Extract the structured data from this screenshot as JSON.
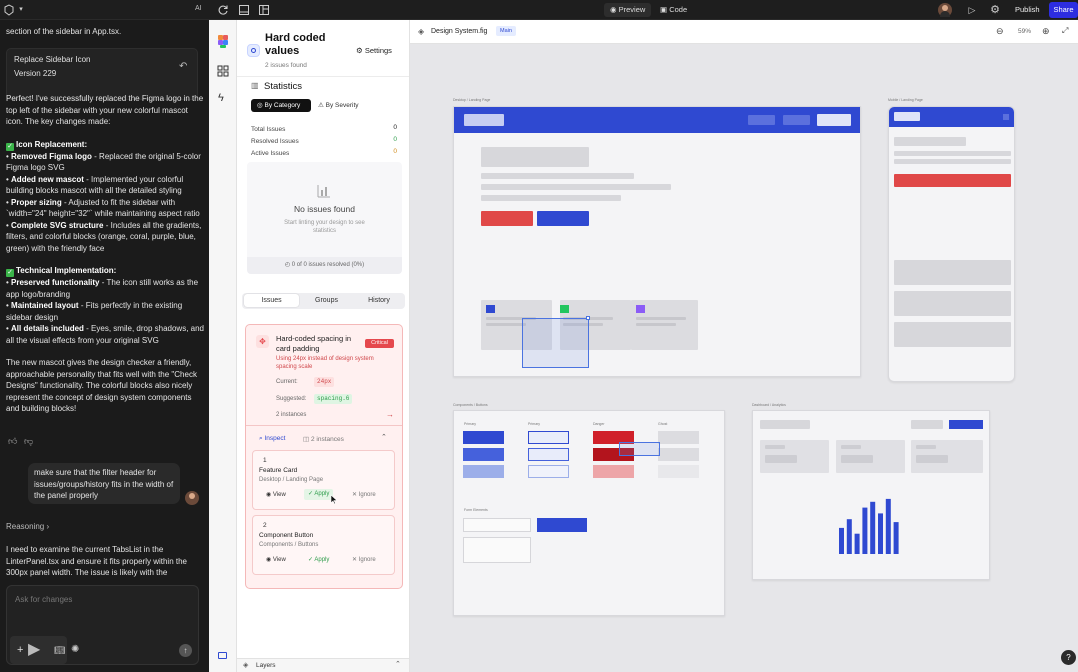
{
  "topbar": {
    "ai_label": "AI",
    "preview_label": "Preview",
    "code_label": "Code",
    "publish_label": "Publish",
    "share_label": "Share"
  },
  "chat": {
    "intro_text": "section of the sidebar in App.tsx.",
    "version_card": {
      "title": "Replace Sidebar Icon",
      "version": "Version 229"
    },
    "summary": "Perfect! I've successfully replaced the Figma logo in the top left of the sidebar with your new colorful mascot icon. The key changes made:",
    "icon_heading": "Icon Replacement:",
    "icon_items": [
      {
        "bold": "Removed Figma logo",
        "text": " - Replaced the original 5-color Figma logo SVG"
      },
      {
        "bold": "Added new mascot",
        "text": " - Implemented your colorful building blocks mascot with all the detailed styling"
      },
      {
        "bold": "Proper sizing",
        "text": " - Adjusted to fit the sidebar with `width=\"24\" height=\"32\"` while maintaining aspect ratio"
      },
      {
        "bold": "Complete SVG structure",
        "text": " - Includes all the gradients, filters, and colorful blocks (orange, coral, purple, blue, green) with the friendly face"
      }
    ],
    "tech_heading": "Technical Implementation:",
    "tech_items": [
      {
        "bold": "Preserved functionality",
        "text": " - The icon still works as the app logo/branding"
      },
      {
        "bold": "Maintained layout",
        "text": " - Fits perfectly in the existing sidebar design"
      },
      {
        "bold": "All details included",
        "text": " - Eyes, smile, drop shadows, and all the visual effects from your original SVG"
      }
    ],
    "closing": "The new mascot gives the design checker a friendly, approachable personality that fits well with the \"Check Designs\" functionality. The colorful blocks also nicely represent the concept of design system components and building blocks!",
    "user_message": "make sure that the filter header for issues/groups/history fits in the width of the panel properly",
    "reasoning_label": "Reasoning",
    "reasoning_text": "I need to examine the current TabsList in the LinterPanel.tsx and ensure it fits properly within the 300px panel width. The issue is likely with the",
    "input_placeholder": "Ask for changes"
  },
  "panel": {
    "title": "Hard coded values",
    "subtitle": "2 issues found",
    "settings_label": "Settings",
    "statistics_label": "Statistics",
    "by_category": "By Category",
    "by_severity": "By Severity",
    "stats": [
      {
        "label": "Total Issues",
        "value": "0",
        "color": "#222222"
      },
      {
        "label": "Resolved Issues",
        "value": "0",
        "color": "#2e9d4b"
      },
      {
        "label": "Active Issues",
        "value": "0",
        "color": "#d08a1a"
      }
    ],
    "empty_title": "No issues found",
    "empty_sub": "Start linting your design to see statistics",
    "resolved_text": "0 of 0 issues resolved (0%)",
    "tabs": [
      "Issues",
      "Groups",
      "History"
    ],
    "issue": {
      "title": "Hard-coded spacing in card padding",
      "badge": "Critical",
      "desc": "Using 24px instead of design system spacing scale",
      "current_label": "Current:",
      "current_value": "24px",
      "suggested_label": "Suggested:",
      "suggested_value": "spacing.6",
      "instances_text": "2 instances",
      "inspect_label": "Inspect",
      "inspect_count": "2 instances"
    },
    "instances": [
      {
        "num": "1",
        "name": "Feature Card",
        "path": "Desktop / Landing Page"
      },
      {
        "num": "2",
        "name": "Component Button",
        "path": "Components / Buttons"
      }
    ],
    "view_label": "View",
    "apply_label": "Apply",
    "ignore_label": "Ignore",
    "layers_label": "Layers"
  },
  "canvas": {
    "file_name": "Design System.fig",
    "branch": "Main",
    "zoom": "59%",
    "frames": {
      "desktop": "Desktop / Landing Page",
      "mobile": "Mobile / Landing Page",
      "components": "Components / Buttons",
      "dashboard": "Dashboard / Analytics"
    },
    "component_labels": [
      "Primary",
      "Primary",
      "Danger",
      "Ghost"
    ],
    "form_label": "Form Elements",
    "chart_bars": [
      0.45,
      0.6,
      0.35,
      0.8,
      0.9,
      0.7,
      0.95,
      0.55
    ]
  },
  "colors": {
    "accent_blue": "#2f49d1",
    "danger_red": "#e04848",
    "critical_red": "#e5484d",
    "share_blue": "#2d2de0"
  }
}
